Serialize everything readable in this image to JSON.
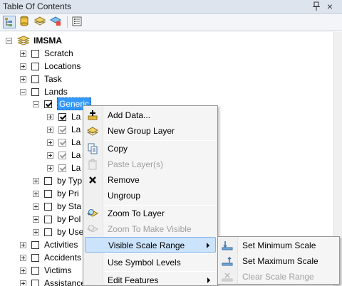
{
  "window": {
    "title": "Table Of Contents",
    "pin_glyph": "ᵽ",
    "close_glyph": "×"
  },
  "toolbar": {
    "buttons": [
      "list-by-drawing-order-icon",
      "list-by-source-icon",
      "list-by-visibility-icon",
      "list-by-selection-icon",
      "options-icon"
    ]
  },
  "tree": {
    "root": {
      "label": "IMSMA"
    },
    "items": [
      {
        "label": "Scratch"
      },
      {
        "label": "Locations"
      },
      {
        "label": "Task"
      },
      {
        "label": "Lands"
      },
      {
        "label": "Generic"
      },
      {
        "label": "La"
      },
      {
        "label": "La"
      },
      {
        "label": "La"
      },
      {
        "label": "La"
      },
      {
        "label": "La"
      },
      {
        "label": "by Typ"
      },
      {
        "label": "by Pri"
      },
      {
        "label": "by Sta"
      },
      {
        "label": "by Pol"
      },
      {
        "label": "by Use"
      },
      {
        "label": "Activities"
      },
      {
        "label": "Accidents"
      },
      {
        "label": "Victims"
      },
      {
        "label": "Assistance"
      }
    ]
  },
  "context_menu": {
    "items": [
      {
        "label": "Add Data...",
        "icon": "add-data-icon"
      },
      {
        "label": "New Group Layer",
        "icon": "new-group-layer-icon"
      },
      {
        "label": "Copy",
        "icon": "copy-icon"
      },
      {
        "label": "Paste Layer(s)",
        "icon": "paste-icon"
      },
      {
        "label": "Remove",
        "icon": "remove-icon"
      },
      {
        "label": "Ungroup",
        "icon": ""
      },
      {
        "label": "Zoom To Layer",
        "icon": "zoom-to-layer-icon"
      },
      {
        "label": "Zoom To Make Visible",
        "icon": "zoom-to-make-visible-icon"
      },
      {
        "label": "Visible Scale Range",
        "icon": ""
      },
      {
        "label": "Use Symbol Levels",
        "icon": ""
      },
      {
        "label": "Edit Features",
        "icon": ""
      }
    ]
  },
  "submenu": {
    "items": [
      {
        "label": "Set Minimum Scale",
        "icon": "set-minimum-scale-icon"
      },
      {
        "label": "Set Maximum Scale",
        "icon": "set-maximum-scale-icon"
      },
      {
        "label": "Clear Scale Range",
        "icon": "clear-scale-range-icon"
      }
    ]
  },
  "colors": {
    "selection": "#3399ff",
    "menu_hover": "#cbe3fb",
    "disabled_text": "#a0a0a0"
  }
}
